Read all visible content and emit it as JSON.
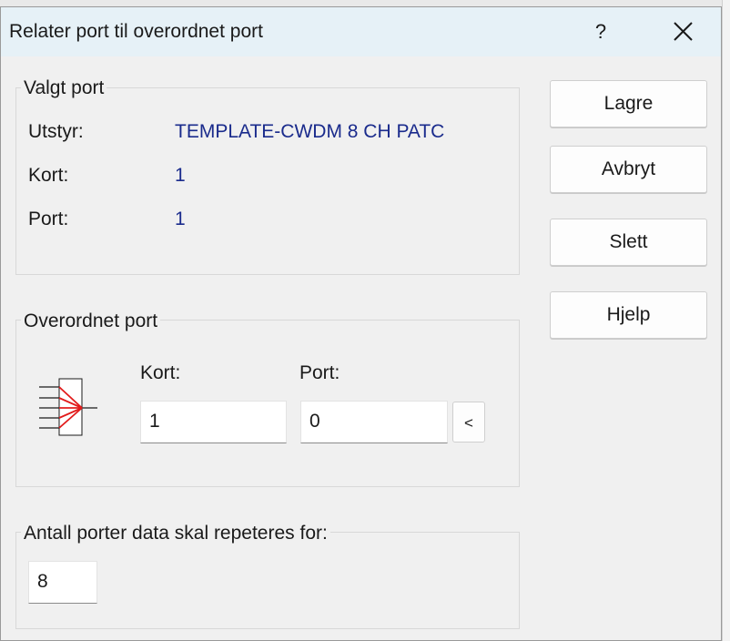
{
  "window": {
    "title": "Relater port til overordnet port",
    "help_glyph": "?",
    "close_icon": "close-icon"
  },
  "selected_port": {
    "legend": "Valgt port",
    "equipment_label": "Utstyr:",
    "equipment_value": "TEMPLATE-CWDM 8 CH PATC",
    "card_label": "Kort:",
    "card_value": "1",
    "port_label": "Port:",
    "port_value": "1"
  },
  "parent_port": {
    "legend": "Overordnet port",
    "diagram_icon": "port-fanout-icon",
    "card_label": "Kort:",
    "card_input_value": "1",
    "port_label": "Port:",
    "port_input_value": "0",
    "pick_button_label": "<"
  },
  "repeat": {
    "legend": "Antall porter data skal repeteres for:",
    "input_value": "8"
  },
  "buttons": {
    "save": "Lagre",
    "cancel": "Avbryt",
    "delete": "Slett",
    "help": "Hjelp"
  },
  "colors": {
    "value_text": "#1a2b8c",
    "titlebar_bg": "#e6f1f7",
    "arrow_red": "#e21b1b"
  }
}
